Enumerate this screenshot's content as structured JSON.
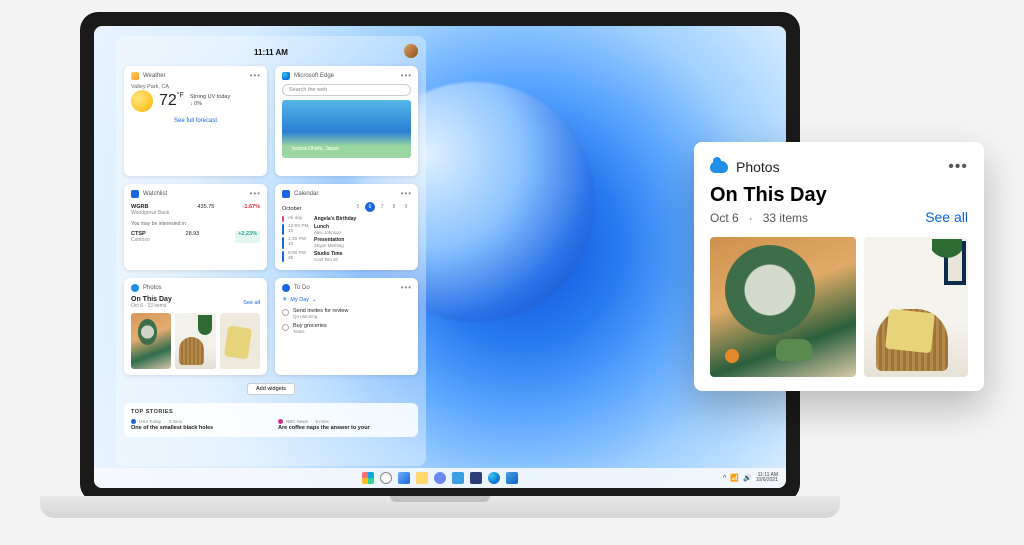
{
  "clock": "11:11 AM",
  "weather": {
    "widget_name": "Weather",
    "location": "Valley Park, CA",
    "temp": "72",
    "temp_unit": "°F",
    "uv": "Strong UV today",
    "change": "↓ 0%",
    "link": "See full forecast"
  },
  "edge": {
    "widget_name": "Microsoft Edge",
    "search_placeholder": "Search the web",
    "hero_caption": "Iwama Ohishi, Japan"
  },
  "watchlist": {
    "widget_name": "Watchlist",
    "items": [
      {
        "sym": "WGRB",
        "sub": "Woodgrove Bank",
        "price": "435.75",
        "change": "-1.67%",
        "neg": true
      },
      {
        "sym": "CTSP",
        "sub": "Contoso",
        "price": "28.93",
        "change": "+2.23%",
        "neg": false
      }
    ],
    "interest_label": "You may be interested in"
  },
  "calendar": {
    "widget_name": "Calendar",
    "month": "October",
    "days": [
      "5",
      "6",
      "7",
      "8",
      "9"
    ],
    "active_day": "6",
    "events": [
      {
        "color": "#e04a7a",
        "time": "All day",
        "title": "Angela's Birthday",
        "sub": ""
      },
      {
        "color": "#1a66e0",
        "time": "12:00 PM 1h",
        "title": "Lunch",
        "sub": "Alex Johnson"
      },
      {
        "color": "#1a66e0",
        "time": "1:30 PM 1h",
        "title": "Presentation",
        "sub": "Skype Meeting"
      },
      {
        "color": "#1a66e0",
        "time": "6:00 PM 3h",
        "title": "Studio Time",
        "sub": "Conf Rm 20"
      }
    ]
  },
  "photos_small": {
    "widget_name": "Photos",
    "title": "On This Day",
    "date": "Oct 6",
    "count": "33 items",
    "see_all": "See all"
  },
  "todo": {
    "widget_name": "To Do",
    "list_label": "My Day",
    "items": [
      {
        "title": "Send invites for review",
        "sub": "Q4 planning"
      },
      {
        "title": "Buy groceries",
        "sub": "Tasks"
      }
    ]
  },
  "add_widgets_label": "Add widgets",
  "news": {
    "header": "TOP STORIES",
    "items": [
      {
        "color": "#1a66e0",
        "source": "USA Today",
        "age": "3 mins",
        "title": "One of the smallest black holes"
      },
      {
        "color": "#d02a90",
        "source": "NBC News",
        "age": "5 mins",
        "title": "Are coffee naps the answer to your"
      }
    ]
  },
  "taskbar": {
    "tray_time": "11:11 AM",
    "tray_date": "10/6/2021"
  },
  "popout": {
    "app_name": "Photos",
    "title": "On This Day",
    "date": "Oct 6",
    "separator": "·",
    "count": "33 items",
    "see_all": "See all"
  }
}
